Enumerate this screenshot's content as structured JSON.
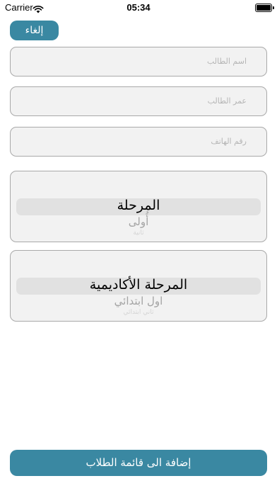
{
  "status_bar": {
    "carrier": "Carrier",
    "time": "05:34",
    "wifi_icon": "wifi-icon",
    "battery_icon": "battery-icon"
  },
  "cancel_button": {
    "label": "إلغاء"
  },
  "form": {
    "student_name": {
      "placeholder": "اسم الطالب",
      "value": ""
    },
    "student_age": {
      "placeholder": "عمر الطالب",
      "value": ""
    },
    "phone_number": {
      "placeholder": "رقم الهاتف",
      "value": ""
    }
  },
  "stage_picker": {
    "selected": "المرحلة",
    "next": "أُولى",
    "next2": "ثانية"
  },
  "academic_stage_picker": {
    "selected": "المرحلة الأكاديمية",
    "next": "اول ابتدائي",
    "next2": "ثاني ابتدائي"
  },
  "add_button": {
    "label": "إضافة الى قائمة الطلاب"
  },
  "colors": {
    "accent": "#3a88a2",
    "field_bg": "#f2f2f2",
    "field_border": "#a9a9a9"
  }
}
